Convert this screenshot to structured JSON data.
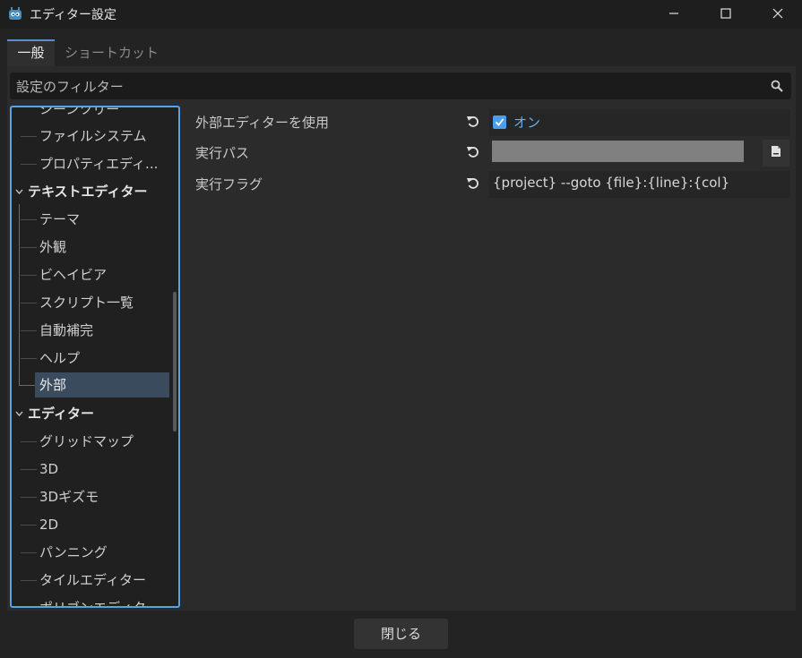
{
  "window": {
    "title": "エディター設定",
    "icon": "godot-icon",
    "minimize_icon": "minimize-icon",
    "maximize_icon": "maximize-icon",
    "close_icon": "close-icon"
  },
  "tabs": [
    {
      "label": "一般",
      "active": true
    },
    {
      "label": "ショートカット",
      "active": false
    }
  ],
  "filter": {
    "placeholder": "設定のフィルター",
    "icon": "search-icon"
  },
  "tree": {
    "items": [
      {
        "label": "シーンツリー",
        "kind": "child",
        "partial": true
      },
      {
        "label": "ファイルシステム",
        "kind": "child"
      },
      {
        "label": "プロパティエディ...",
        "kind": "child"
      },
      {
        "label": "テキストエディター",
        "kind": "section"
      },
      {
        "label": "テーマ",
        "kind": "child"
      },
      {
        "label": "外観",
        "kind": "child"
      },
      {
        "label": "ビヘイビア",
        "kind": "child"
      },
      {
        "label": "スクリプト一覧",
        "kind": "child"
      },
      {
        "label": "自動補完",
        "kind": "child"
      },
      {
        "label": "ヘルプ",
        "kind": "child"
      },
      {
        "label": "外部",
        "kind": "child",
        "selected": true
      },
      {
        "label": "エディター",
        "kind": "section"
      },
      {
        "label": "グリッドマップ",
        "kind": "child"
      },
      {
        "label": "3D",
        "kind": "child"
      },
      {
        "label": "3Dギズモ",
        "kind": "child"
      },
      {
        "label": "2D",
        "kind": "child"
      },
      {
        "label": "パンニング",
        "kind": "child"
      },
      {
        "label": "タイルエディター",
        "kind": "child"
      },
      {
        "label": "ポリゴンエディター",
        "kind": "child",
        "partial": true
      }
    ]
  },
  "properties": [
    {
      "label": "外部エディターを使用",
      "type": "checkbox",
      "checked": true,
      "value_label": "オン"
    },
    {
      "label": "実行パス",
      "type": "path",
      "value": ""
    },
    {
      "label": "実行フラグ",
      "type": "text",
      "value": "{project} --goto {file}:{line}:{col}"
    }
  ],
  "footer": {
    "close_label": "閉じる"
  },
  "colors": {
    "accent": "#5aa2e6",
    "checkbox": "#4d9ee8",
    "on_text": "#6ab0f0",
    "selected_row": "#3b4b5e"
  }
}
